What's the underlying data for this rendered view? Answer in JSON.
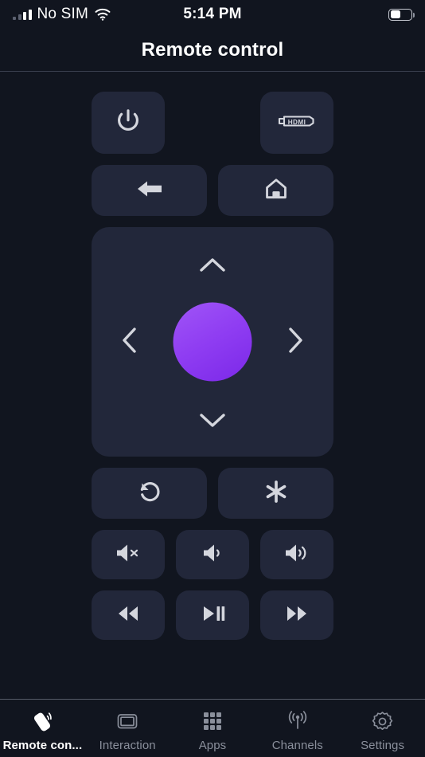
{
  "status_bar": {
    "carrier": "No SIM",
    "time": "5:14 PM",
    "signal_icon": "cellular-signal-icon",
    "wifi_icon": "wifi-icon",
    "battery_icon": "battery-icon",
    "battery_level_percent": 52
  },
  "header": {
    "title": "Remote control"
  },
  "theme": {
    "background": "#11151f",
    "button_background": "#22273a",
    "icon_color": "#d4d6dd",
    "accent": "#8f3df2",
    "accent_light": "#a055f7",
    "tab_inactive": "#8a8f9b",
    "tab_active": "#ffffff"
  },
  "remote": {
    "row_power": [
      {
        "name": "power-button",
        "icon": "power-icon",
        "label": "Power"
      },
      {
        "name": "hdmi-button",
        "icon": "hdmi-icon",
        "label": "HDMI",
        "icon_text": "HDMI"
      }
    ],
    "row_nav": [
      {
        "name": "back-button",
        "icon": "arrow-left-icon",
        "label": "Back"
      },
      {
        "name": "home-button",
        "icon": "home-icon",
        "label": "Home"
      }
    ],
    "dpad": {
      "up": {
        "name": "dpad-up-button",
        "icon": "chevron-up-icon",
        "label": "Up"
      },
      "down": {
        "name": "dpad-down-button",
        "icon": "chevron-down-icon",
        "label": "Down"
      },
      "left": {
        "name": "dpad-left-button",
        "icon": "chevron-left-icon",
        "label": "Left"
      },
      "right": {
        "name": "dpad-right-button",
        "icon": "chevron-right-icon",
        "label": "Right"
      },
      "ok": {
        "name": "dpad-ok-button",
        "label": "OK"
      }
    },
    "row_misc": [
      {
        "name": "rotate-button",
        "icon": "rotate-ccw-icon",
        "label": "Rotate"
      },
      {
        "name": "asterisk-button",
        "icon": "asterisk-icon",
        "label": "Asterisk"
      }
    ],
    "row_volume": [
      {
        "name": "mute-button",
        "icon": "volume-mute-icon",
        "label": "Mute"
      },
      {
        "name": "volume-down-button",
        "icon": "volume-low-icon",
        "label": "Volume down"
      },
      {
        "name": "volume-up-button",
        "icon": "volume-high-icon",
        "label": "Volume up"
      }
    ],
    "row_media": [
      {
        "name": "rewind-button",
        "icon": "rewind-icon",
        "label": "Rewind"
      },
      {
        "name": "play-pause-button",
        "icon": "play-pause-icon",
        "label": "Play / Pause"
      },
      {
        "name": "fast-forward-button",
        "icon": "fast-forward-icon",
        "label": "Fast forward"
      }
    ]
  },
  "tabbar": {
    "items": [
      {
        "name": "tab-remote-control",
        "label": "Remote con...",
        "icon": "remote-icon",
        "active": true
      },
      {
        "name": "tab-interaction",
        "label": "Interaction",
        "icon": "screen-icon",
        "active": false
      },
      {
        "name": "tab-apps",
        "label": "Apps",
        "icon": "grid-icon",
        "active": false
      },
      {
        "name": "tab-channels",
        "label": "Channels",
        "icon": "broadcast-icon",
        "active": false
      },
      {
        "name": "tab-settings",
        "label": "Settings",
        "icon": "gear-icon",
        "active": false
      }
    ]
  }
}
